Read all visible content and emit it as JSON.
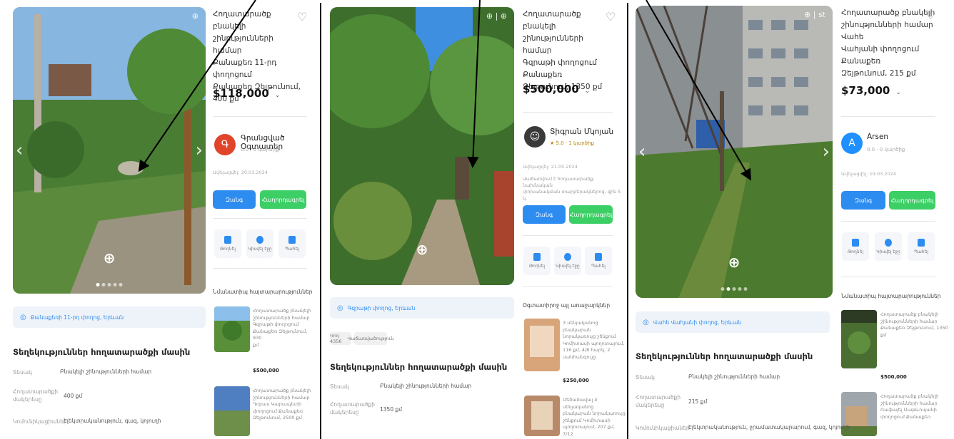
{
  "listings": [
    {
      "title_lines": [
        "Հողատարածք բնակելի",
        "շինությունների համար",
        "Քանաքեռ 11-րդ փողոցում",
        "Քանաքեռ Զեյթունում, 400 քմ"
      ],
      "price": "$118,000",
      "price_chevron": "⌄",
      "seller_initial": "Գ",
      "seller_name": "Գրանցված Օգտատեր",
      "seller_sub": "0.0 · 0 կարծիք",
      "date": "Ավելացվել: 20.03.2024",
      "desc_lines": [],
      "call_label": "Զանգ",
      "message_label": "Հաղորդագրել",
      "actions": [
        "Թողնել",
        "Կիսվել էջը",
        "Պահել"
      ],
      "similar_heading": "Նմանատիպ հայտարարություններ",
      "similar": [
        {
          "text_lines": [
            "Հողատարածք բնակելի",
            "շինությունների համար",
            "Գզրաթի փողոցում",
            "Քանաքեռ Զեյթունում, 930",
            "քմ"
          ],
          "price": "$500,000"
        },
        {
          "text_lines": [
            "Հողատարածք բնակելի",
            "շինությունների համար",
            "Դոբաս Կարապետի",
            "փողոցում Քանաքեռ",
            "Զեյթունում, 2500 քմ"
          ],
          "price": ""
        }
      ],
      "location": "Քանաքեռի 11-րդ փողոց, Երևան",
      "tags": [],
      "info_title": "Տեղեկություններ հողատարածքի մասին",
      "info_rows": [
        {
          "key": [
            "Տեսակ"
          ],
          "value": "Բնակելի շինությունների համար"
        },
        {
          "key": [
            "Հողատարածքի",
            "մակերեսը"
          ],
          "value": "400 քմ"
        },
        {
          "key": [
            "Կոմունիկացիաներ"
          ],
          "value": "Էլեկտրականություն, գազ, կոյուղի"
        }
      ],
      "corner_icons": "⊕",
      "photo_dots": 5
    },
    {
      "title_lines": [
        "Հողատարածք բնակելի",
        "շինությունների համար",
        "Գզրաթի փողոցում Քանաքեռ",
        "Զեյթունում, 1350 քմ"
      ],
      "price": "$500,000",
      "price_chevron": "⌄",
      "seller_initial": "",
      "seller_name": "Տիգրան Մկոյան",
      "seller_sub": "★ 5.0 · 1 կարծիք",
      "date": "Ավելացվել: 21.05.2024",
      "desc_lines": [
        "Վաճառվում է հողատարածք, նախնական",
        "փոխանակման տարբերակներով, գին 5 կ."
      ],
      "call_label": "Զանգ",
      "message_label": "Հաղորդագրել",
      "actions": [
        "Թողնել",
        "Կիսվել էջը",
        "Պահել"
      ],
      "similar_heading": "Օգտատիրոջ այլ առաջարկներ",
      "similar": [
        {
          "text_lines": [
            "3 սենյականոց բնակարան",
            "նորակառույց շենքում",
            "Կոմիտասի պողոտայում,",
            "116 քմ, 4/8 հարկ, 2",
            "սանհանգույց"
          ],
          "price": "$250,000"
        },
        {
          "text_lines": [
            "Մեծածավալ 4 սենյականոց",
            "բնակարան նորակառույց",
            "շենքում Կոմիտասի",
            "պողոտայում, 207 քմ, 7/12"
          ],
          "price": ""
        }
      ],
      "location": "Գզրաթի փողոց, Երևան",
      "tags": [
        "Կոդ 4356",
        "Վաճառվածություն"
      ],
      "info_title": "Տեղեկություններ հողատարածքի մասին",
      "info_rows": [
        {
          "key": [
            "Տեսակ"
          ],
          "value": "Բնակելի շինությունների համար"
        },
        {
          "key": [
            "Հողատարածքի",
            "մակերեսը"
          ],
          "value": "1350 քմ"
        }
      ],
      "corner_icons": "⊕ | ⊕",
      "photo_dots": 0
    },
    {
      "title_lines": [
        "Հողատարածք բնակելի",
        "շինությունների համար Վահե",
        "Վահյանի փողոցում Քանաքեռ",
        "Զեյթունում, 215 քմ"
      ],
      "price": "$73,000",
      "price_chevron": "⌄",
      "seller_initial": "A",
      "seller_name": "Arsen",
      "seller_sub": "0.0 · 0 կարծիք",
      "date": "Ավելացվել: 19.03.2024",
      "desc_lines": [],
      "call_label": "Զանգ",
      "message_label": "Հաղորդագրել",
      "actions": [
        "Թողնել",
        "Կիսվել էջը",
        "Պահել"
      ],
      "similar_heading": "Նմանատիպ հայտարարություններ",
      "similar": [
        {
          "text_lines": [
            "Հողատարածք բնակելի",
            "շինությունների համար",
            "Քանաքեռ Զեյթունում, 1350",
            "քմ"
          ],
          "price": "$500,000"
        },
        {
          "text_lines": [
            "Հողատարածք բնակելի",
            "շինությունների համար",
            "Ռաֆայել Մաթևոսյանի",
            "փողոցում Քանաքեռ"
          ],
          "price": ""
        }
      ],
      "location": "Վահե Վահյանի փողոց, Երևան",
      "tags": [],
      "info_title": "Տեղեկություններ հողատարածքի մասին",
      "info_rows": [
        {
          "key": [
            "Տեսակ"
          ],
          "value": "Բնակելի շինությունների համար"
        },
        {
          "key": [
            "Հողատարածքի",
            "մակերեսը"
          ],
          "value": "215 քմ"
        },
        {
          "key": [
            "Կոմունիկացիաներ"
          ],
          "value": "Էլեկտրականություն, ջրամատակարարում, գազ, կոյուղի"
        }
      ],
      "corner_icons": "⊕ | st",
      "photo_dots": 5
    }
  ],
  "colors": {
    "primary_blue": "#2d8cf0",
    "green": "#3ccf66",
    "avatar_red": "#e0452c",
    "avatar_blue": "#1e90ff"
  }
}
